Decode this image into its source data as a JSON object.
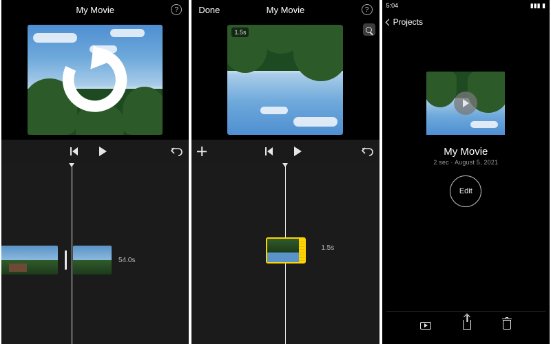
{
  "panel1": {
    "title": "My Movie",
    "help_tooltip": "?",
    "controls": {
      "skip_back": "skip-back",
      "play": "play",
      "undo": "undo"
    },
    "timeline": {
      "clip_duration": "54.0s"
    }
  },
  "panel2": {
    "done": "Done",
    "title": "My Movie",
    "help_tooltip": "?",
    "preview_badge": "1.5s",
    "controls": {
      "add": "add",
      "skip_back": "skip-back",
      "play": "play",
      "undo": "undo"
    },
    "timeline": {
      "selected_duration": "1.5s"
    }
  },
  "panel3": {
    "status_time": "5:04",
    "back_label": "Projects",
    "project_title": "My Movie",
    "project_meta": "2 sec · August 5, 2021",
    "edit_label": "Edit",
    "footer": {
      "play": "play",
      "share": "share",
      "delete": "delete"
    }
  }
}
